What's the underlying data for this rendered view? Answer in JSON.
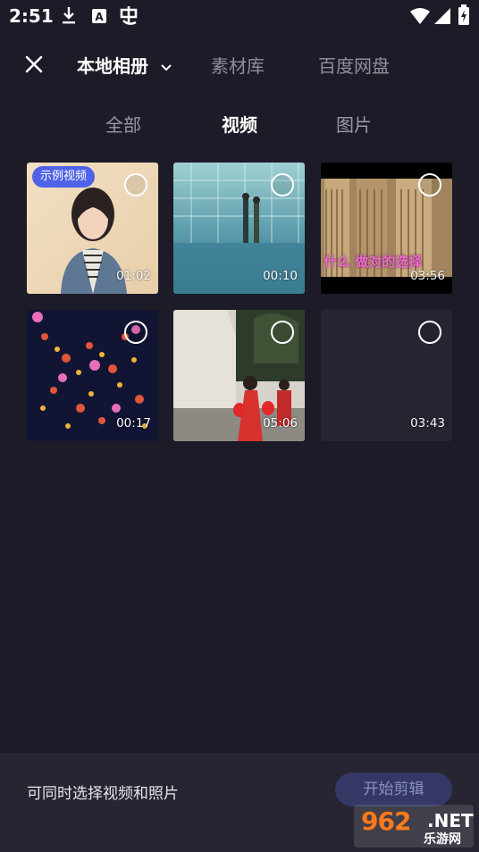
{
  "status_bar": {
    "time": "2:51",
    "icons": [
      "download-icon",
      "a-app-icon",
      "bug-icon",
      "wifi-icon",
      "signal-icon",
      "battery-charging-icon"
    ]
  },
  "nav": {
    "close_icon": "close-icon",
    "sources": [
      {
        "label": "本地相册",
        "active": true,
        "icon": "chevron-down-icon"
      },
      {
        "label": "素材库",
        "active": false
      },
      {
        "label": "百度网盘",
        "active": false
      }
    ]
  },
  "filters": [
    {
      "label": "全部",
      "active": false
    },
    {
      "label": "视频",
      "active": true
    },
    {
      "label": "图片",
      "active": false
    }
  ],
  "media": [
    {
      "duration": "01:02",
      "badge": "示例视频",
      "thumb": "woman-portrait"
    },
    {
      "duration": "00:10",
      "thumb": "anime-rain-scene"
    },
    {
      "duration": "03:56",
      "caption": "什么  做对的选择",
      "thumb": "karaoke-buildings"
    },
    {
      "duration": "00:17",
      "thumb": "flowers-night"
    },
    {
      "duration": "05:06",
      "thumb": "village-lanterns"
    },
    {
      "duration": "03:43",
      "thumb": "empty"
    }
  ],
  "bottom": {
    "hint": "可同时选择视频和照片",
    "start_label": "开始剪辑"
  },
  "watermark": {
    "brand": "962",
    "suffix": ".NET",
    "sub": "乐游网"
  }
}
